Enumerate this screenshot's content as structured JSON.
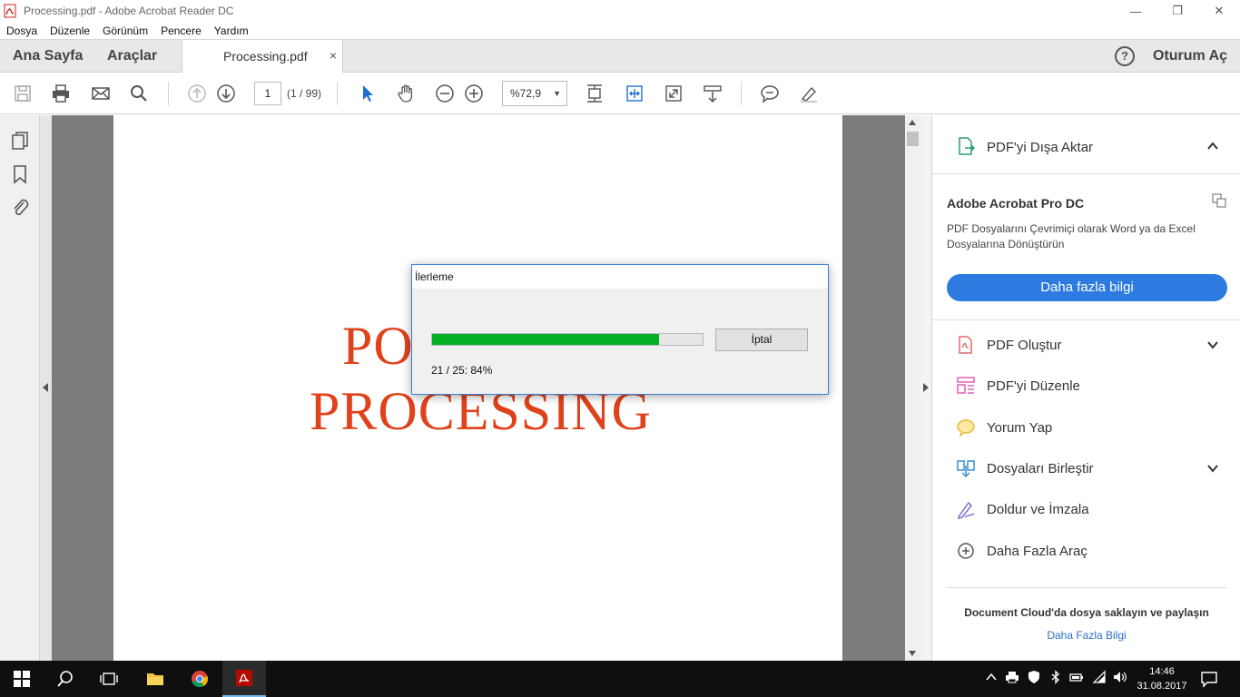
{
  "window": {
    "title": "Processing.pdf - Adobe Acrobat Reader DC",
    "minimize": "—",
    "restore": "❐",
    "close": "✕"
  },
  "menu": [
    "Dosya",
    "Düzenle",
    "Görünüm",
    "Pencere",
    "Yardım"
  ],
  "tabs": {
    "home": "Ana Sayfa",
    "tools": "Araçlar",
    "document": "Processing.pdf",
    "close": "×",
    "help": "?",
    "signin": "Oturum Aç"
  },
  "toolbar": {
    "page_value": "1",
    "page_count": "(1 / 99)",
    "zoom": "%72,9"
  },
  "document": {
    "line1": "PO",
    "line2": "PROCESSING"
  },
  "dialog": {
    "title": "İlerleme",
    "cancel_label": "İptal",
    "progress_text": "21 / 25: 84%",
    "progress_fraction": 0.84
  },
  "right_panel": {
    "export_label": "PDF'yi Dışa Aktar",
    "promo_title": "Adobe Acrobat Pro DC",
    "promo_desc": "PDF Dosyalarını Çevrimiçi olarak Word ya da Excel Dosyalarına Dönüştürün",
    "learn_more": "Daha fazla bilgi",
    "tools": [
      {
        "label": "PDF Oluştur"
      },
      {
        "label": "PDF'yi Düzenle"
      },
      {
        "label": "Yorum Yap"
      },
      {
        "label": "Dosyaları Birleştir"
      },
      {
        "label": "Doldur ve İmzala"
      },
      {
        "label": "Daha Fazla Araç"
      }
    ],
    "cloud_title": "Document Cloud'da dosya saklayın ve paylaşın",
    "cloud_link": "Daha Fazla Bilgi"
  },
  "taskbar": {
    "time": "14:46",
    "date": "31.08.2017"
  },
  "colors": {
    "accent_blue": "#2d7be0",
    "progress_green": "#06b025",
    "document_text": "#e0421b"
  }
}
